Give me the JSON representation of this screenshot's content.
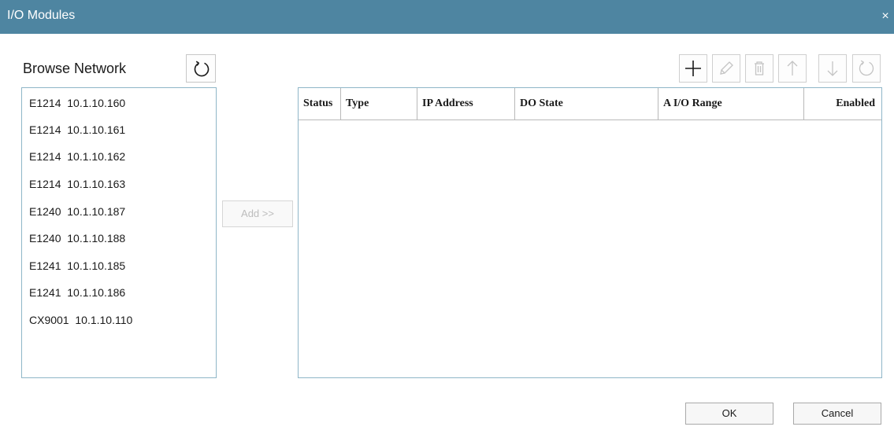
{
  "window": {
    "title": "I/O Modules",
    "close_glyph": "×"
  },
  "browse": {
    "label": "Browse Network",
    "refresh_icon": "refresh-icon",
    "items": [
      "E1214  10.1.10.160",
      "E1214  10.1.10.161",
      "E1214  10.1.10.162",
      "E1214  10.1.10.163",
      "E1240  10.1.10.187",
      "E1240  10.1.10.188",
      "E1241  10.1.10.185",
      "E1241  10.1.10.186",
      "CX9001  10.1.10.110"
    ]
  },
  "add_button": "Add >>",
  "toolbar": {
    "buttons": [
      {
        "name": "add",
        "icon": "plus-icon",
        "enabled": true
      },
      {
        "name": "edit",
        "icon": "pencil-icon",
        "enabled": false
      },
      {
        "name": "delete",
        "icon": "trash-icon",
        "enabled": false
      },
      {
        "name": "move-up",
        "icon": "arrow-up-icon",
        "enabled": false
      },
      {
        "name": "move-down",
        "icon": "arrow-down-icon",
        "enabled": false
      },
      {
        "name": "refresh",
        "icon": "refresh-icon",
        "enabled": false
      }
    ]
  },
  "table": {
    "columns": [
      "Status",
      "Type",
      "IP Address",
      "DO State",
      "A I/O Range",
      "Enabled"
    ],
    "rows": []
  },
  "footer": {
    "ok": "OK",
    "cancel": "Cancel"
  },
  "colors": {
    "titlebar": "#4e85a1",
    "border_accent": "#8fb6c8",
    "disabled": "#bdbdbd"
  }
}
